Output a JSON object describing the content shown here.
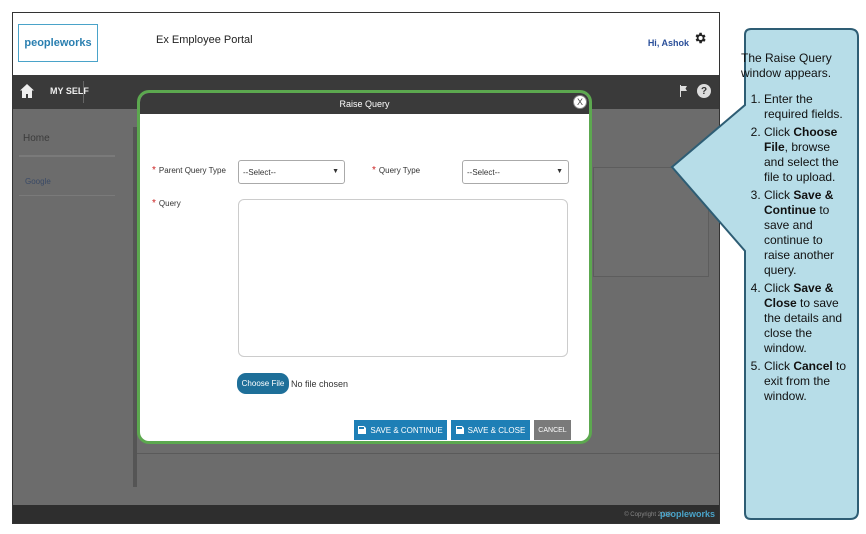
{
  "header": {
    "logo_text": "peopleworks",
    "portal_title": "Ex Employee Portal",
    "greeting": "Hi, Ashok"
  },
  "navbar": {
    "myself_label": "MY SELF"
  },
  "sidebar": {
    "items": [
      {
        "label": "Home"
      },
      {
        "label": "Google"
      }
    ]
  },
  "modal": {
    "title": "Raise Query",
    "close_label": "X",
    "fields": {
      "parent_query_type": {
        "label": "Parent Query Type",
        "value": "--Select--"
      },
      "query_type": {
        "label": "Query Type",
        "value": "--Select--"
      },
      "query": {
        "label": "Query",
        "value": ""
      }
    },
    "required_marker": "*",
    "choose_file_label": "Choose File",
    "no_file_text": "No file chosen",
    "buttons": {
      "save_continue": "SAVE & CONTINUE",
      "save_close": "SAVE & CLOSE",
      "cancel": "CANCEL"
    }
  },
  "footer": {
    "copyright": "© Copyright 2018",
    "logo_text": "peopleworks"
  },
  "callout": {
    "intro": "The Raise Query window appears.",
    "steps": [
      {
        "pre": "Enter the required fields.",
        "b1": "",
        "mid": "",
        "b2": "",
        "post": ""
      },
      {
        "pre": "Click ",
        "b1": "Choose File",
        "mid": ", browse and select the file to upload.",
        "b2": "",
        "post": ""
      },
      {
        "pre": "Click ",
        "b1": "Save & Continue",
        "mid": " to save and continue to raise another query.",
        "b2": "",
        "post": ""
      },
      {
        "pre": "Click ",
        "b1": "Save & Close",
        "mid": " to save the details and close the window.",
        "b2": "",
        "post": ""
      },
      {
        "pre": "Click ",
        "b1": "Cancel",
        "mid": " to exit from the window.",
        "b2": "",
        "post": ""
      }
    ]
  },
  "colors": {
    "modal_border": "#5ca84f",
    "primary_button": "#1e7fb6",
    "callout_fill": "#b7dde8",
    "callout_stroke": "#2e5d74"
  }
}
